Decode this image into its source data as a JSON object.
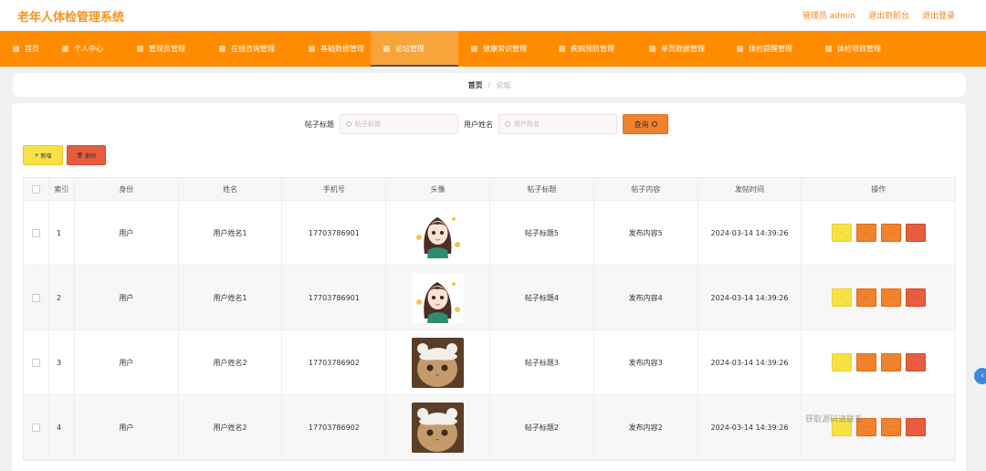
{
  "app": {
    "title": "老年人体检管理系统"
  },
  "top_links": [
    "管理员 admin",
    "退出到前台",
    "退出登录"
  ],
  "nav": [
    {
      "label": "首页",
      "icon": "home-icon",
      "active": false
    },
    {
      "label": "个人中心",
      "icon": "user-icon",
      "active": false
    },
    {
      "label": "管理员管理",
      "icon": "admin-icon",
      "active": false
    },
    {
      "label": "在线咨询管理",
      "icon": "chat-icon",
      "active": false
    },
    {
      "label": "基础数据管理",
      "icon": "data-icon",
      "active": false
    },
    {
      "label": "论坛管理",
      "icon": "forum-icon",
      "active": true
    },
    {
      "label": "健康常识管理",
      "icon": "health-icon",
      "active": false
    },
    {
      "label": "疾病预防管理",
      "icon": "shield-icon",
      "active": false
    },
    {
      "label": "单页数据管理",
      "icon": "page-icon",
      "active": false
    },
    {
      "label": "体检提醒管理",
      "icon": "bell-icon",
      "active": false
    },
    {
      "label": "体检项目管理",
      "icon": "list-icon",
      "active": false
    }
  ],
  "breadcrumb": {
    "home": "首页",
    "sep": "/",
    "current": "论坛"
  },
  "search": {
    "title_label": "帖子标题",
    "title_placeholder": "帖子标题",
    "user_label": "用户姓名",
    "user_placeholder": "用户姓名",
    "query_label": "查询"
  },
  "actions": {
    "add_label": "新增",
    "delete_label": "删除"
  },
  "table": {
    "headers": [
      "索引",
      "身份",
      "姓名",
      "手机号",
      "头像",
      "帖子标题",
      "帖子内容",
      "发帖时间",
      "操作"
    ],
    "rows": [
      {
        "index": "1",
        "role": "用户",
        "name": "用户姓名1",
        "phone": "17703786901",
        "avatar": "girl",
        "title": "帖子标题5",
        "content": "发布内容5",
        "time": "2024-03-14 14:39:26"
      },
      {
        "index": "2",
        "role": "用户",
        "name": "用户姓名1",
        "phone": "17703786901",
        "avatar": "girl",
        "title": "帖子标题4",
        "content": "发布内容4",
        "time": "2024-03-14 14:39:26"
      },
      {
        "index": "3",
        "role": "用户",
        "name": "用户姓名2",
        "phone": "17703786902",
        "avatar": "cat",
        "title": "帖子标题3",
        "content": "发布内容3",
        "time": "2024-03-14 14:39:26"
      },
      {
        "index": "4",
        "role": "用户",
        "name": "用户姓名2",
        "phone": "17703786902",
        "avatar": "cat",
        "title": "帖子标题2",
        "content": "发布内容2",
        "time": "2024-03-14 14:39:26"
      }
    ]
  },
  "colors": {
    "nav_bg": "#ff8c00",
    "accent": "#f7931e",
    "yellow": "#f7e246",
    "orange": "#f0822c",
    "red": "#e75d3e"
  },
  "watermark": "获取源码请联系"
}
